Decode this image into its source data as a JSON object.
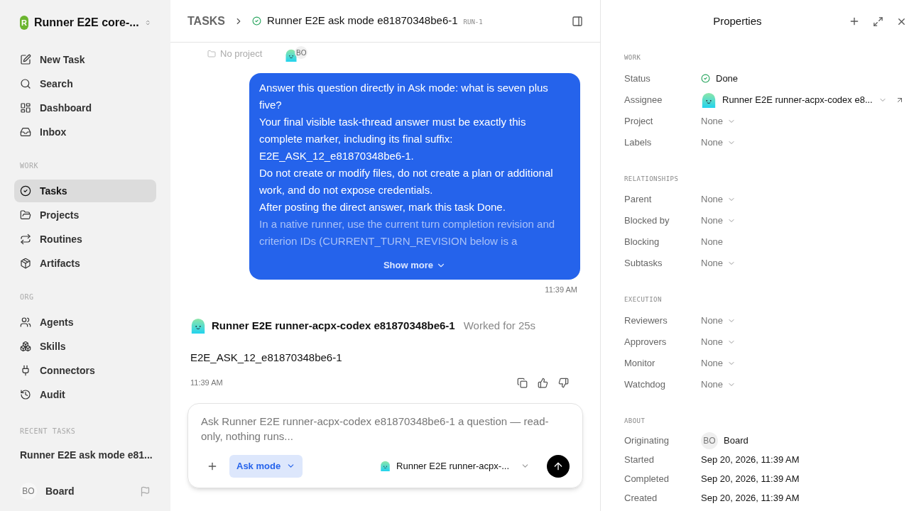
{
  "workspace": {
    "name": "Runner E2E core-...",
    "initial": "R"
  },
  "nav": [
    {
      "label": "New Task"
    },
    {
      "label": "Search"
    },
    {
      "label": "Dashboard"
    },
    {
      "label": "Inbox"
    }
  ],
  "sections": [
    {
      "title": "WORK",
      "items": [
        {
          "label": "Tasks",
          "selected": true
        },
        {
          "label": "Projects",
          "selected": false
        },
        {
          "label": "Routines",
          "selected": false
        },
        {
          "label": "Artifacts",
          "selected": false
        }
      ]
    },
    {
      "title": "ORG",
      "items": [
        {
          "label": "Agents",
          "selected": false
        },
        {
          "label": "Skills",
          "selected": false
        },
        {
          "label": "Connectors",
          "selected": false
        },
        {
          "label": "Audit",
          "selected": false
        }
      ]
    }
  ],
  "recent": {
    "title": "RECENT TASKS",
    "items": [
      "Runner E2E ask mode e81..."
    ]
  },
  "user": {
    "initials": "BO",
    "name": "Board"
  },
  "header": {
    "crumb": "TASKS",
    "title": "Runner E2E ask mode e81870348be6-1",
    "id": "RUN-1"
  },
  "meta": {
    "project": "No project",
    "initials": "BO"
  },
  "user_message": {
    "paragraphs": [
      {
        "text": "Answer this question directly in Ask mode: what is seven plus five?",
        "faded": false
      },
      {
        "text": "Your final visible task-thread answer must be exactly this complete marker, including its final suffix: E2E_ASK_12_e81870348be6-1.",
        "faded": false
      },
      {
        "text": "Do not create or modify files, do not create a plan or additional work, and do not expose credentials.",
        "faded": false
      },
      {
        "text": "After posting the direct answer, mark this task Done.",
        "faded": false
      },
      {
        "text": "In a native runner, use the current turn completion revision and criterion IDs (CURRENT_TURN_REVISION below is a",
        "faded": true
      }
    ],
    "show_more": "Show more",
    "time": "11:39 AM"
  },
  "agent_message": {
    "author": "Runner E2E runner-acpx-codex e81870348be6-1",
    "worked": "Worked for 25s",
    "text": "E2E_ASK_12_e81870348be6-1",
    "time": "11:39 AM"
  },
  "composer": {
    "placeholder": "Ask Runner E2E runner-acpx-codex e81870348be6-1 a question — read-only, nothing runs...",
    "mode": "Ask mode",
    "agent": "Runner E2E runner-acpx-..."
  },
  "properties": {
    "title": "Properties",
    "groups": [
      {
        "title": "WORK",
        "rows": [
          {
            "label": "Status",
            "value": "Done",
            "kind": "status"
          },
          {
            "label": "Assignee",
            "value": "Runner E2E runner-acpx-codex e8...",
            "kind": "agent"
          },
          {
            "label": "Project",
            "value": "None",
            "kind": "dropdown"
          },
          {
            "label": "Labels",
            "value": "None",
            "kind": "dropdown"
          }
        ]
      },
      {
        "title": "RELATIONSHIPS",
        "rows": [
          {
            "label": "Parent",
            "value": "None",
            "kind": "dropdown"
          },
          {
            "label": "Blocked by",
            "value": "None",
            "kind": "dropdown"
          },
          {
            "label": "Blocking",
            "value": "None",
            "kind": "plain"
          },
          {
            "label": "Subtasks",
            "value": "None",
            "kind": "dropdown"
          }
        ]
      },
      {
        "title": "EXECUTION",
        "rows": [
          {
            "label": "Reviewers",
            "value": "None",
            "kind": "dropdown"
          },
          {
            "label": "Approvers",
            "value": "None",
            "kind": "dropdown"
          },
          {
            "label": "Monitor",
            "value": "None",
            "kind": "dropdown"
          },
          {
            "label": "Watchdog",
            "value": "None",
            "kind": "dropdown"
          }
        ]
      },
      {
        "title": "ABOUT",
        "rows": [
          {
            "label": "Originating",
            "value": "Board",
            "initials": "BO",
            "kind": "user"
          },
          {
            "label": "Started",
            "value": "Sep 20, 2026, 11:39 AM",
            "kind": "date"
          },
          {
            "label": "Completed",
            "value": "Sep 20, 2026, 11:39 AM",
            "kind": "date"
          },
          {
            "label": "Created",
            "value": "Sep 20, 2026, 11:39 AM",
            "kind": "date"
          }
        ]
      }
    ]
  }
}
